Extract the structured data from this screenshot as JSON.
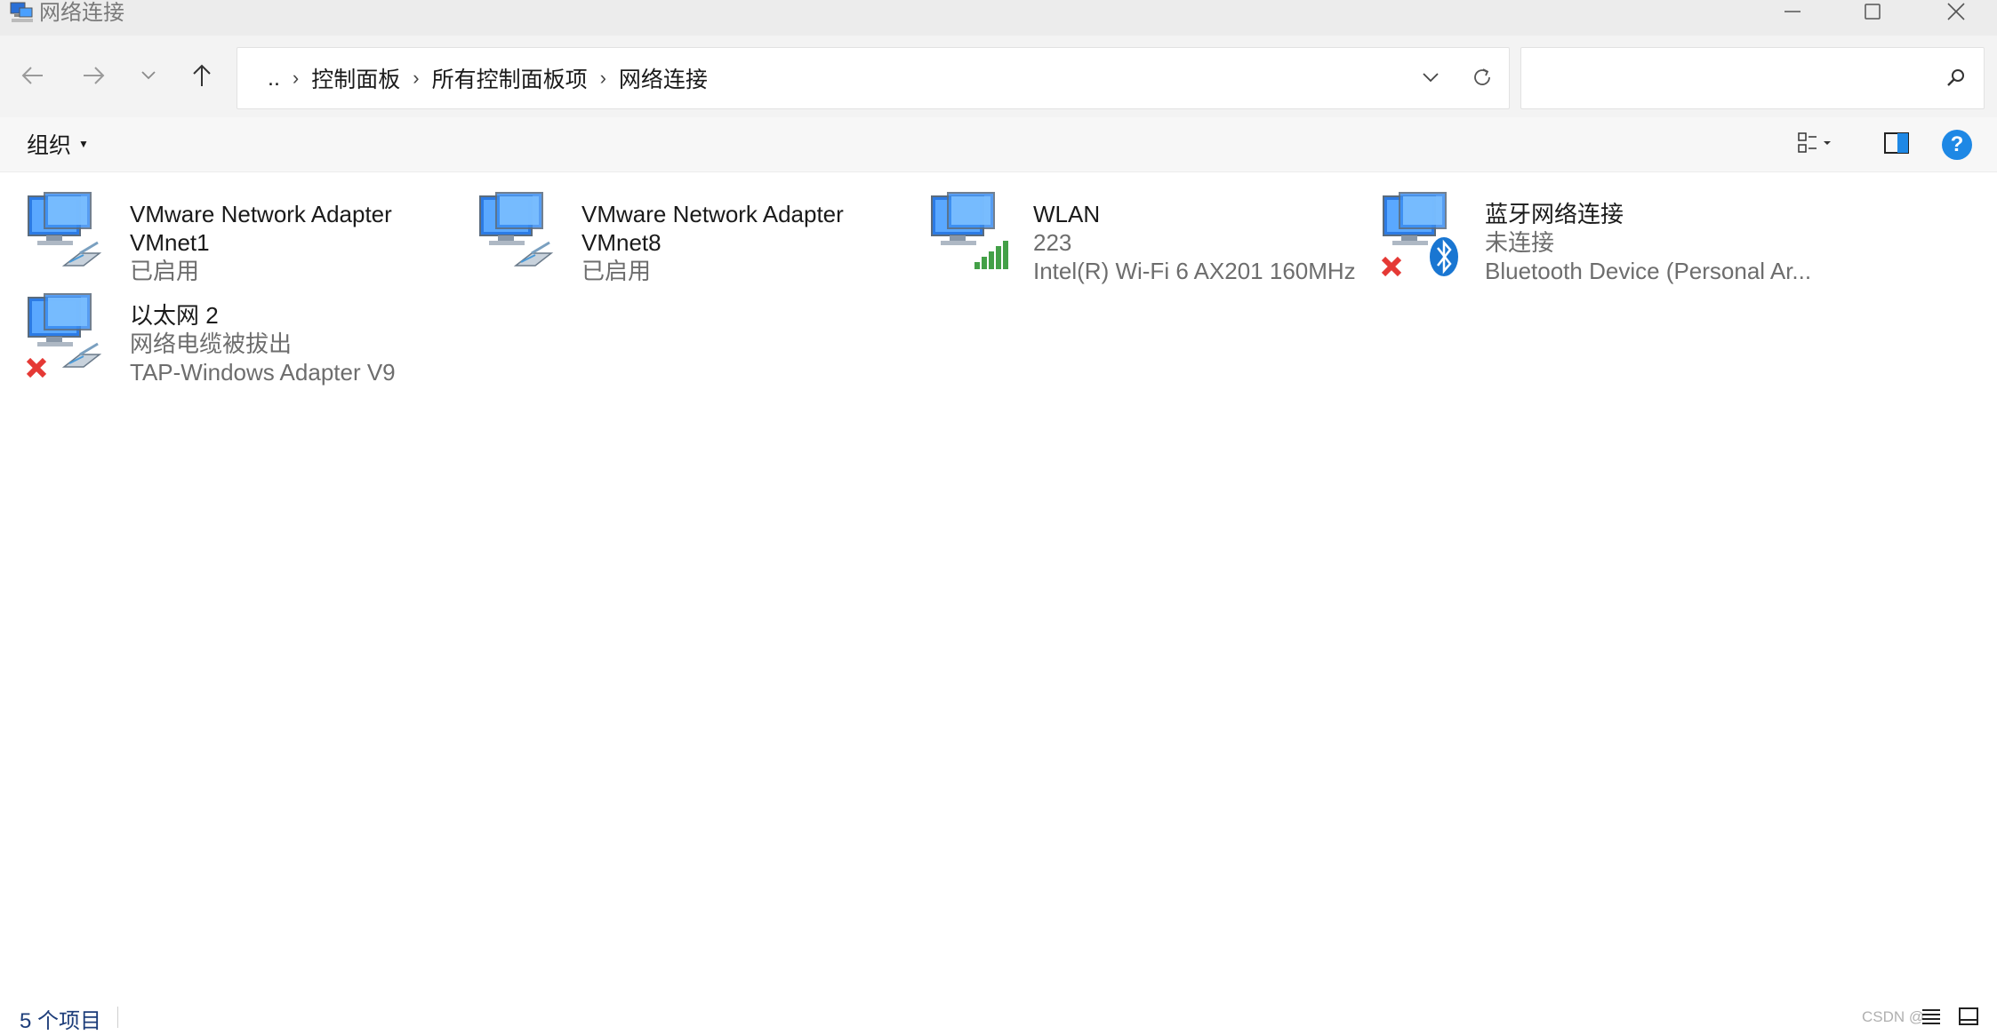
{
  "window": {
    "title": "网络连接",
    "minimize_icon": "minimize-icon",
    "maximize_icon": "maximize-icon",
    "close_icon": "close-icon"
  },
  "nav": {
    "back_icon": "arrow-left-icon",
    "forward_icon": "arrow-right-icon",
    "recent_icon": "chevron-down-icon",
    "up_icon": "arrow-up-icon"
  },
  "address": {
    "overflow": "..",
    "crumbs": [
      "控制面板",
      "所有控制面板项",
      "网络连接"
    ],
    "dropdown_icon": "chevron-down-icon",
    "refresh_icon": "refresh-icon"
  },
  "search": {
    "value": "",
    "placeholder": "",
    "icon": "search-icon"
  },
  "commandbar": {
    "organize_label": "组织",
    "view_icon": "view-options-icon",
    "preview_icon": "preview-pane-icon",
    "help_icon": "help-icon",
    "help_label": "?"
  },
  "connections": [
    {
      "name": "VMware Network Adapter",
      "name2": "VMnet1",
      "status": "已启用",
      "device": "",
      "icon": "ethernet-adapter-icon",
      "disconnected": false
    },
    {
      "name": "VMware Network Adapter",
      "name2": "VMnet8",
      "status": "已启用",
      "device": "",
      "icon": "ethernet-adapter-icon",
      "disconnected": false
    },
    {
      "name": "WLAN",
      "name2": "",
      "status": "223",
      "device": "Intel(R) Wi-Fi 6 AX201 160MHz",
      "icon": "wifi-adapter-icon",
      "disconnected": false
    },
    {
      "name": "蓝牙网络连接",
      "name2": "",
      "status": "未连接",
      "device": "Bluetooth Device (Personal Ar...",
      "icon": "bluetooth-adapter-icon",
      "disconnected": true
    },
    {
      "name": "以太网 2",
      "name2": "",
      "status": "网络电缆被拔出",
      "device": "TAP-Windows Adapter V9",
      "icon": "ethernet-adapter-icon",
      "disconnected": true
    }
  ],
  "statusbar": {
    "item_count": "5 个项目",
    "watermark": "CSDN @"
  },
  "colors": {
    "titlebar": "#ececec",
    "navbar": "#f3f3f3",
    "status_text": "#1d3d7a",
    "help_blue": "#1e88e5",
    "disconnected_red": "#e53935",
    "wifi_green": "#43a047",
    "bluetooth_blue": "#1976d2"
  }
}
